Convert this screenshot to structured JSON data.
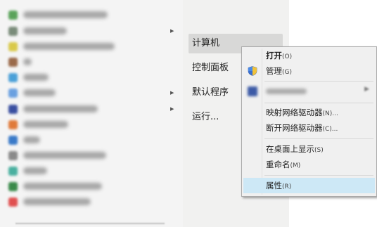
{
  "start_menu": {
    "programs": [
      {
        "icon": "app-icon",
        "color": "#5aa35a",
        "text_width": 120,
        "submenu": false
      },
      {
        "icon": "app-icon",
        "color": "#7a8c7a",
        "text_width": 62,
        "submenu": true
      },
      {
        "icon": "app-icon",
        "color": "#d9c94a",
        "text_width": 130,
        "submenu": false
      },
      {
        "icon": "app-icon",
        "color": "#9a6a4a",
        "text_width": 12,
        "submenu": false
      },
      {
        "icon": "app-icon",
        "color": "#4aa0d8",
        "text_width": 36,
        "submenu": false
      },
      {
        "icon": "app-icon",
        "color": "#6aa0e0",
        "text_width": 46,
        "submenu": true
      },
      {
        "icon": "app-icon",
        "color": "#3a4fa0",
        "text_width": 106,
        "submenu": true
      },
      {
        "icon": "app-icon",
        "color": "#e07a3a",
        "text_width": 64,
        "submenu": false
      },
      {
        "icon": "app-icon",
        "color": "#3a7ac8",
        "text_width": 24,
        "submenu": false
      },
      {
        "icon": "app-icon",
        "color": "#8a8a8a",
        "text_width": 118,
        "submenu": false
      },
      {
        "icon": "app-icon",
        "color": "#4ab0a0",
        "text_width": 34,
        "submenu": false
      },
      {
        "icon": "app-icon",
        "color": "#3a8a4a",
        "text_width": 112,
        "submenu": false
      },
      {
        "icon": "app-icon",
        "color": "#e05050",
        "text_width": 96,
        "submenu": false
      }
    ],
    "right_items": {
      "computer": "计算机",
      "control_panel": "控制面板",
      "default_programs": "默认程序",
      "run": "运行..."
    }
  },
  "context_menu": {
    "open": {
      "label": "打开",
      "key": "(O)"
    },
    "manage": {
      "label": "管理",
      "key": "(G)"
    },
    "map_drive": {
      "label": "映射网络驱动器",
      "key": "(N)..."
    },
    "disconnect_drive": {
      "label": "断开网络驱动器",
      "key": "(C)..."
    },
    "show_desktop": {
      "label": "在桌面上显示",
      "key": "(S)"
    },
    "rename": {
      "label": "重命名",
      "key": "(M)"
    },
    "properties": {
      "label": "属性",
      "key": "(R)"
    }
  },
  "colors": {
    "hover": "#cde8f6",
    "selected": "#d8d8d7"
  }
}
